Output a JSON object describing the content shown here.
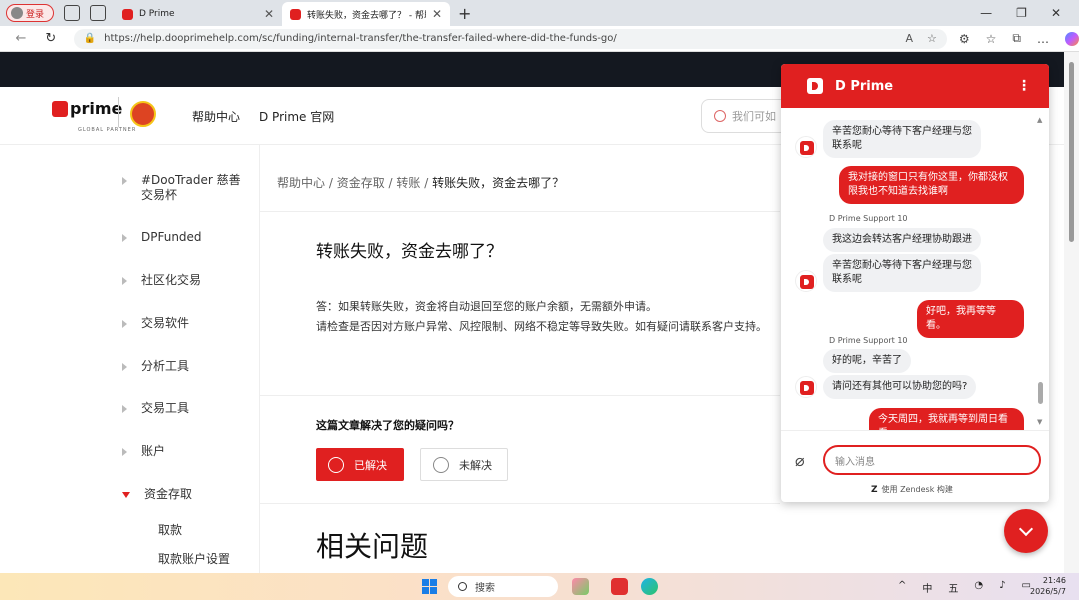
{
  "browser": {
    "profile_label": "登录",
    "tabs": [
      {
        "title": "D Prime",
        "active": false
      },
      {
        "title": "转账失败，资金去哪了？ - 帮助中",
        "active": true
      }
    ],
    "new_tab": "+",
    "url": "https://help.dooprimehelp.com/sc/funding/internal-transfer/the-transfer-failed-where-did-the-funds-go/"
  },
  "header": {
    "logo_text": "prime",
    "logo_sub": "GLOBAL PARTNER",
    "nav": [
      "帮助中心",
      "D Prime 官网"
    ],
    "search_placeholder": "我们可如"
  },
  "sidebar": {
    "items": [
      {
        "label": "#DooTrader 慈善交易杯",
        "expanded": false
      },
      {
        "label": "DPFunded",
        "expanded": false
      },
      {
        "label": "社区化交易",
        "expanded": false
      },
      {
        "label": "交易软件",
        "expanded": false
      },
      {
        "label": "分析工具",
        "expanded": false
      },
      {
        "label": "交易工具",
        "expanded": false
      },
      {
        "label": "账户",
        "expanded": false
      },
      {
        "label": "资金存取",
        "expanded": true
      }
    ],
    "subitems": [
      "取款",
      "取款账户设置"
    ]
  },
  "article": {
    "breadcrumb": [
      "帮助中心",
      "资金存取",
      "转账"
    ],
    "breadcrumb_current": "转账失败，资金去哪了？",
    "title": "转账失败，资金去哪了？",
    "body_line1": "答：如果转账失败，资金将自动退回至您的账户余额，无需额外申请。",
    "body_line2": "请检查是否因对方账户异常、风控限制、网络不稳定等导致失败。如有疑问请联系客户支持。",
    "helpful_question": "这篇文章解决了您的疑问吗？",
    "solved_label": "已解决",
    "unsolved_label": "未解决",
    "related_title": "相关问题"
  },
  "chat": {
    "brand": "D Prime",
    "menu_icon": "⋮",
    "agent_name": "D Prime Support 10",
    "messages": [
      {
        "from": "agent",
        "text": "辛苦您耐心等待下客户经理与您联系呢"
      },
      {
        "from": "user",
        "text": "我对接的窗口只有你这里，你都没权限我也不知道去找谁啊"
      },
      {
        "from": "agent",
        "text": "我这边会转达客户经理协助跟进"
      },
      {
        "from": "agent",
        "text": "辛苦您耐心等待下客户经理与您联系呢"
      },
      {
        "from": "user",
        "text": "好吧，我再等等看。"
      },
      {
        "from": "agent",
        "text": "好的呢，辛苦了"
      },
      {
        "from": "agent",
        "text": "请问还有其他可以协助您的吗?"
      },
      {
        "from": "user",
        "text": "今天周四，我就再等到周日看看"
      }
    ],
    "input_placeholder": "输入消息",
    "powered_by": "使用 Zendesk 构建"
  },
  "taskbar": {
    "search_label": "搜索",
    "tray": [
      "^",
      "中",
      "五"
    ],
    "time": "21:46",
    "date": "2026/5/7"
  }
}
